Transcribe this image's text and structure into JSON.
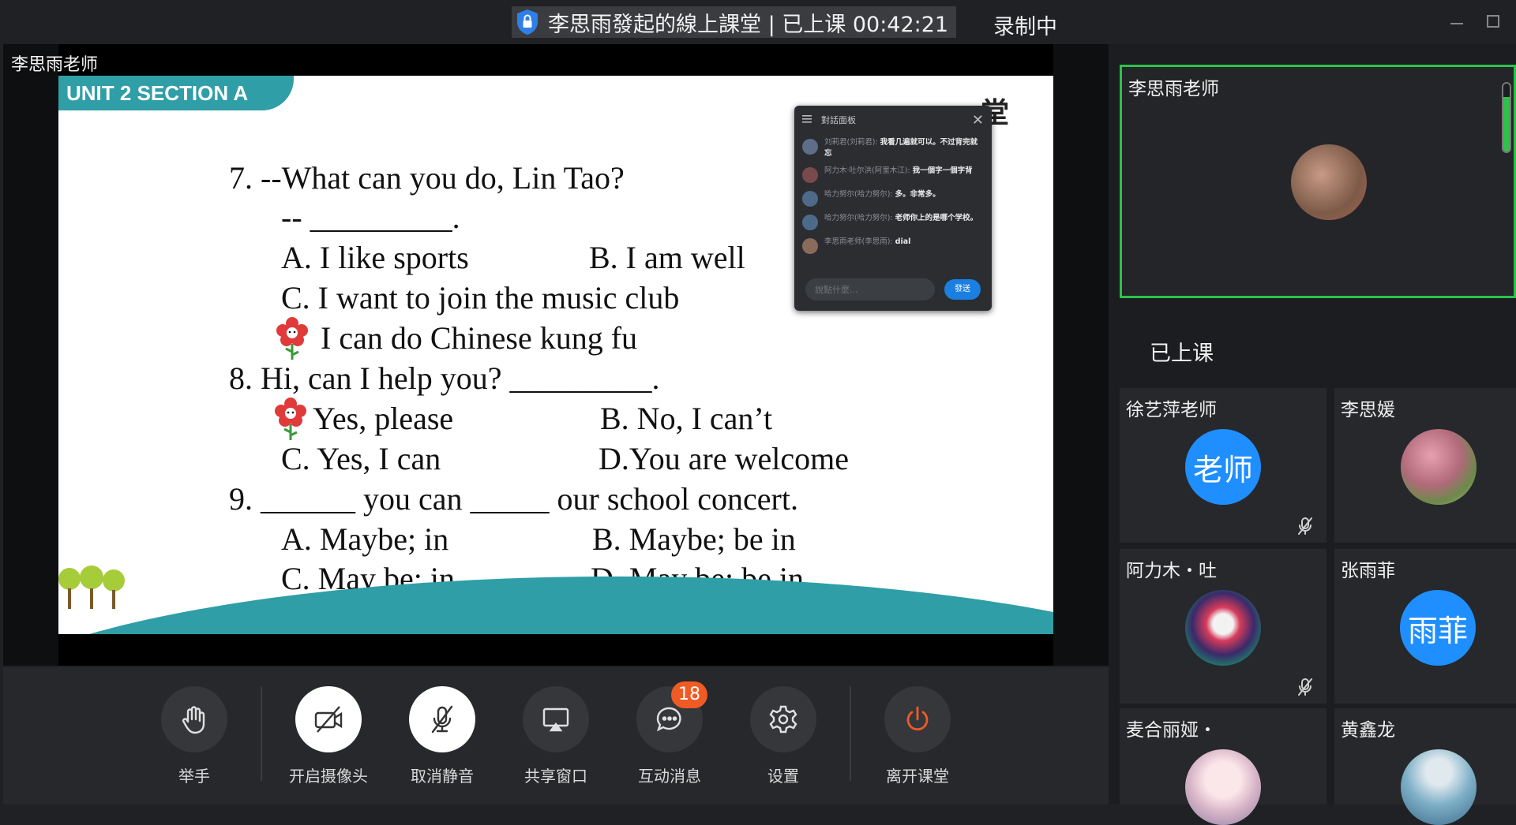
{
  "window": {
    "title": "李思雨發起的線上課堂 | 已上课 00:42:21",
    "recording": "录制中"
  },
  "stage": {
    "presenter_name": "李思雨老师",
    "slide": {
      "unit_tab": "UNIT 2  SECTION A",
      "corner_text": "堂",
      "lines": [
        "7. --What can you do, Lin Tao?",
        "-- _________.",
        "A. I like sports",
        "B. I am well",
        "C. I want to join the music club",
        "I can do Chinese kung fu",
        "8. Hi, can I help you?  _________.",
        "Yes, please",
        "B. No, I can’t",
        "C. Yes, I can",
        "D.You are welcome",
        "9. ______ you can _____ our school concert.",
        "A. Maybe; in",
        "B. Maybe; be in",
        "C. May be; in",
        "D. May be; be in"
      ]
    },
    "chat": {
      "title": "對話面板",
      "close": "✕",
      "messages": [
        {
          "who": "刘莉君(刘莉君):",
          "what": "我看几遍就可以。不过背完就忘"
        },
        {
          "who": "阿力木·吐尔洪(阿里木江):",
          "what": "我一個字一個字背"
        },
        {
          "who": "哈力努尔(哈力努尔):",
          "what": "多。非常多。"
        },
        {
          "who": "哈力努尔(哈力努尔):",
          "what": "老师你上的是哪个学校。"
        },
        {
          "who": "李思雨老师(李思雨):",
          "what": "dial"
        }
      ],
      "input_placeholder": "說點什麼...",
      "send_label": "發送"
    }
  },
  "toolbar": {
    "items": [
      {
        "label": "举手",
        "icon": "raise-hand-icon"
      },
      {
        "label": "开启摄像头",
        "icon": "camera-off-icon"
      },
      {
        "label": "取消静音",
        "icon": "mic-off-icon"
      },
      {
        "label": "共享窗口",
        "icon": "share-screen-icon"
      },
      {
        "label": "互动消息",
        "icon": "chat-bubble-icon",
        "badge": "18"
      },
      {
        "label": "设置",
        "icon": "gear-icon"
      },
      {
        "label": "离开课堂",
        "icon": "power-icon"
      }
    ]
  },
  "panel": {
    "teacher_name": "李思雨老师",
    "section_label": "已上课",
    "participants": [
      {
        "name": "徐艺萍老师",
        "avatar_text": "老师",
        "muted": true
      },
      {
        "name": "李思媛",
        "avatar_text": "",
        "muted": true
      },
      {
        "name": "阿力木・吐",
        "avatar_text": "",
        "muted": true
      },
      {
        "name": "张雨菲",
        "avatar_text": "雨菲",
        "muted": true
      },
      {
        "name": "麦合丽娅・",
        "avatar_text": "",
        "muted": false
      },
      {
        "name": "黄鑫龙",
        "avatar_text": "",
        "muted": false
      }
    ]
  },
  "colors": {
    "accent_green": "#2ec24a",
    "avatar_blue": "#1f8fff",
    "badge_orange": "#f05b24",
    "slide_teal": "#2f9ea6"
  }
}
